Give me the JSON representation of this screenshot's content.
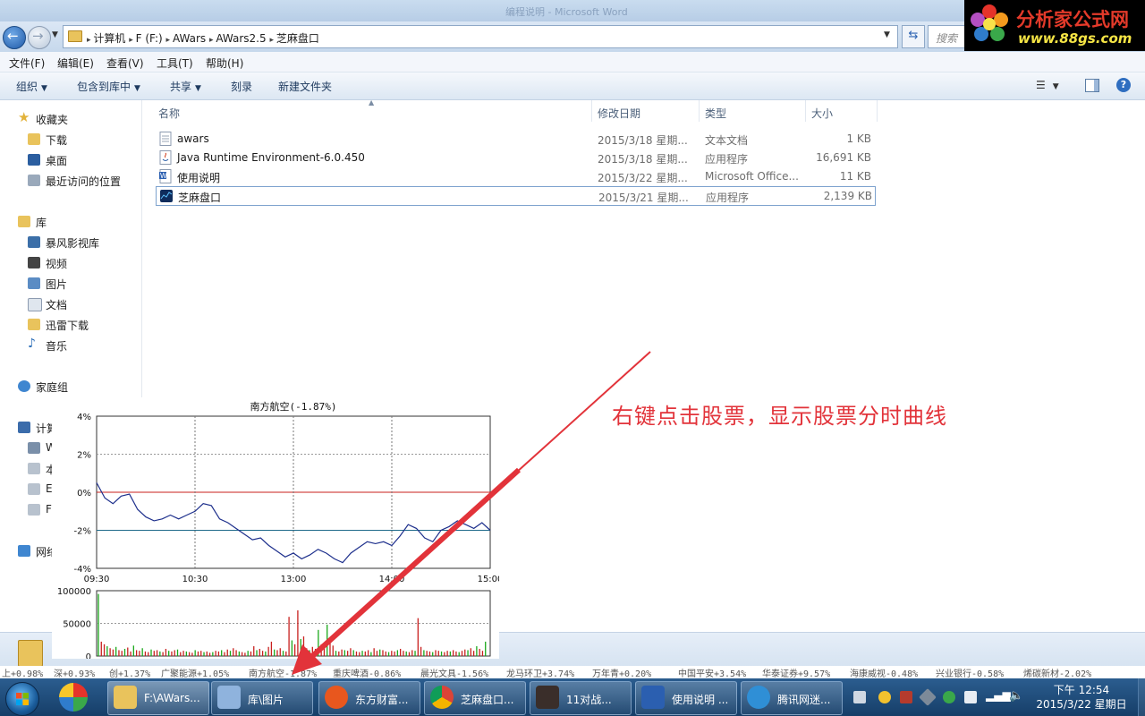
{
  "window": {
    "title": "编程说明 - Microsoft Word"
  },
  "address": {
    "crumbs": [
      "计算机",
      "F (F:)",
      "AWars",
      "AWars2.5",
      "芝麻盘口"
    ],
    "search_placeholder": "搜索"
  },
  "logo": {
    "line1": "分析家公式网",
    "line2": "www.88gs.com"
  },
  "menu": [
    "文件(F)",
    "编辑(E)",
    "查看(V)",
    "工具(T)",
    "帮助(H)"
  ],
  "commands": {
    "organize": "组织",
    "include_library": "包含到库中",
    "share": "共享",
    "burn": "刻录",
    "new_folder": "新建文件夹"
  },
  "nav": {
    "favorites": "收藏夹",
    "downloads": "下载",
    "desktop": "桌面",
    "recent": "最近访问的位置",
    "libraries": "库",
    "storm": "暴风影视库",
    "videos": "视频",
    "pictures": "图片",
    "documents": "文档",
    "xunlei": "迅雷下载",
    "music": "音乐",
    "homegroup": "家庭组",
    "computer": "计算",
    "drive_w": "W",
    "drive_1": "本",
    "drive_e": "E",
    "drive_f": "F",
    "network": "网络"
  },
  "columns": {
    "name": "名称",
    "date": "修改日期",
    "type": "类型",
    "size": "大小"
  },
  "files": [
    {
      "name": "awars",
      "date": "2015/3/18 星期...",
      "type": "文本文档",
      "size": "1 KB",
      "icon": "text-file-icon"
    },
    {
      "name": "Java Runtime Environment-6.0.450",
      "date": "2015/3/18 星期...",
      "type": "应用程序",
      "size": "16,691 KB",
      "icon": "java-icon"
    },
    {
      "name": "使用说明",
      "date": "2015/3/22 星期...",
      "type": "Microsoft Office...",
      "size": "11 KB",
      "icon": "word-doc-icon"
    },
    {
      "name": "芝麻盘口",
      "date": "2015/3/21 星期...",
      "type": "应用程序",
      "size": "2,139 KB",
      "icon": "app-chart-icon"
    }
  ],
  "chart_data": [
    {
      "type": "line",
      "title": "南方航空(-1.87%)",
      "y_tick_labels": [
        "4%",
        "2%",
        "0%",
        "-2%",
        "-4%"
      ],
      "x_tick_labels": [
        "09:30",
        "10:30",
        "13:00",
        "14:00",
        "15:00"
      ],
      "ylim": [
        -4,
        4
      ],
      "reference_lines": [
        0,
        -2
      ],
      "reference_colors": [
        "#c8201e",
        "#1f6a8a"
      ],
      "line_color": "#1d2f8c",
      "grid": true,
      "x": [
        0,
        5,
        10,
        15,
        20,
        25,
        30,
        35,
        40,
        45,
        50,
        55,
        60,
        65,
        70,
        75,
        80,
        85,
        90,
        95,
        100,
        105,
        110,
        115,
        120,
        125,
        130,
        135,
        140,
        145,
        150,
        155,
        160,
        165,
        170,
        175,
        180,
        185,
        190,
        195,
        200,
        205,
        210,
        215,
        220,
        225,
        230,
        235,
        240
      ],
      "values": [
        0.5,
        -0.3,
        -0.6,
        -0.2,
        -0.1,
        -0.9,
        -1.3,
        -1.5,
        -1.4,
        -1.2,
        -1.4,
        -1.2,
        -1.0,
        -0.6,
        -0.7,
        -1.4,
        -1.6,
        -1.9,
        -2.2,
        -2.5,
        -2.4,
        -2.8,
        -3.1,
        -3.4,
        -3.2,
        -3.5,
        -3.3,
        -3.0,
        -3.2,
        -3.5,
        -3.7,
        -3.2,
        -2.9,
        -2.6,
        -2.7,
        -2.6,
        -2.8,
        -2.3,
        -1.7,
        -1.9,
        -2.4,
        -2.6,
        -2.0,
        -1.8,
        -1.5,
        -1.7,
        -1.9,
        -1.6,
        -2.0
      ]
    },
    {
      "type": "bar",
      "y_tick_labels": [
        "100000",
        "50000",
        "0"
      ],
      "ylim": [
        0,
        100000
      ],
      "colors": {
        "up": "#1aa81a",
        "down": "#c8201e"
      },
      "values": [
        95000,
        22000,
        18000,
        15000,
        12000,
        10000,
        14000,
        9000,
        8000,
        11000,
        13000,
        7000,
        16000,
        9000,
        8000,
        12000,
        7000,
        6000,
        10000,
        8000,
        9000,
        7000,
        6000,
        11000,
        8000,
        7000,
        9000,
        10000,
        6000,
        8000,
        7000,
        6000,
        5000,
        9000,
        7000,
        8000,
        6000,
        7000,
        5000,
        6000,
        8000,
        7000,
        9000,
        6000,
        10000,
        8000,
        12000,
        9000,
        7000,
        6000,
        5000,
        8000,
        7000,
        15000,
        9000,
        11000,
        8000,
        7000,
        14000,
        22000,
        10000,
        9000,
        12000,
        8000,
        7000,
        60000,
        24000,
        18000,
        70000,
        26000,
        30000,
        12000,
        9000,
        14000,
        11000,
        40000,
        18000,
        20000,
        48000,
        26000,
        16000,
        8000,
        7000,
        10000,
        9000,
        8000,
        12000,
        9000,
        7000,
        6000,
        8000,
        7000,
        9000,
        6000,
        12000,
        8000,
        10000,
        9000,
        7000,
        6000,
        8000,
        7000,
        9000,
        11000,
        8000,
        7000,
        6000,
        9000,
        8000,
        58000,
        14000,
        9000,
        8000,
        7000,
        6000,
        9000,
        8000,
        7000,
        6000,
        8000,
        7000,
        9000,
        7000,
        6000,
        8000,
        10000,
        9000,
        12000,
        8000,
        15000,
        11000,
        8000,
        22000
      ]
    }
  ],
  "annotation": {
    "text": "右键点击股票，显示股票分时曲线"
  },
  "ticker": [
    "上+0.98%",
    "深+0.93%",
    "创+1.37%",
    "广聚能源+1.05%",
    "南方航空-1.87%",
    "重庆啤酒-0.86%",
    "晨光文具-1.56%",
    "龙马环卫+3.74%",
    "万年青+0.20%",
    "中国平安+3.54%",
    "华泰证券+9.57%",
    "海康威视-0.48%",
    "兴业银行-0.58%",
    "烯碳新材-2.02%"
  ],
  "taskbar": {
    "tasks": [
      {
        "label": "F:\\AWars...",
        "icon": "folder-icon",
        "active": true
      },
      {
        "label": "库\\图片",
        "icon": "pictures-library-icon",
        "active": false
      },
      {
        "label": "东方财富...",
        "icon": "eastmoney-icon",
        "active": false
      },
      {
        "label": "芝麻盘口...",
        "icon": "chrome-icon",
        "active": false
      },
      {
        "label": "11对战...",
        "icon": "game-icon",
        "active": false
      },
      {
        "label": "使用说明 ...",
        "icon": "word-icon",
        "active": false
      },
      {
        "label": "腾讯网迷...",
        "icon": "tencent-icon",
        "active": false
      }
    ],
    "clock": {
      "time": "下午 12:54",
      "date": "2015/3/22 星期日"
    }
  }
}
